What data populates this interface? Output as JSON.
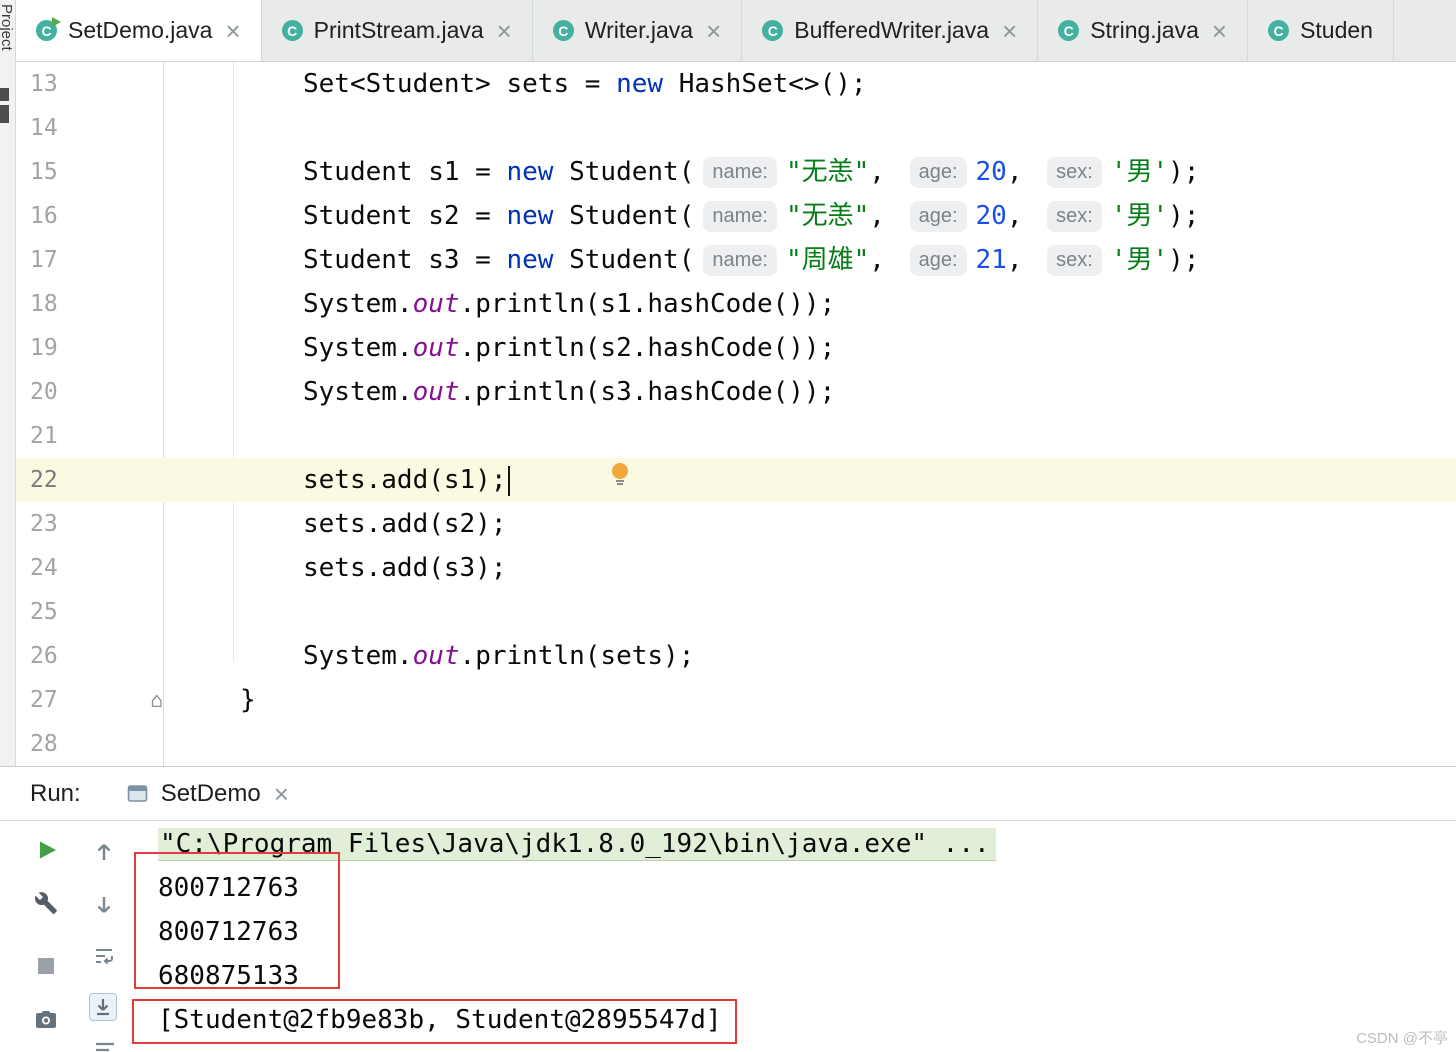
{
  "window": {
    "left_strip_label": "Project"
  },
  "tabs": [
    {
      "label": "SetDemo.java",
      "icon": "class-icon",
      "run_marker": true,
      "active": true,
      "closable": true
    },
    {
      "label": "PrintStream.java",
      "icon": "class-icon",
      "run_marker": false,
      "active": false,
      "closable": true
    },
    {
      "label": "Writer.java",
      "icon": "class-icon",
      "run_marker": false,
      "active": false,
      "closable": true
    },
    {
      "label": "BufferedWriter.java",
      "icon": "class-icon",
      "run_marker": false,
      "active": false,
      "closable": true
    },
    {
      "label": "String.java",
      "icon": "class-icon",
      "run_marker": false,
      "active": false,
      "closable": true
    },
    {
      "label": "Studen",
      "icon": "class-icon",
      "run_marker": false,
      "active": false,
      "closable": false
    }
  ],
  "editor": {
    "lines": [
      {
        "num": "13",
        "indent": 2,
        "tokens": [
          {
            "t": "Set<Student> sets = ",
            "s": "p"
          },
          {
            "t": "new",
            "s": "kw"
          },
          {
            "t": " HashSet<>();",
            "s": "p"
          }
        ]
      },
      {
        "num": "14",
        "indent": 2,
        "tokens": []
      },
      {
        "num": "15",
        "indent": 2,
        "tokens": [
          {
            "t": "Student s1 = ",
            "s": "p"
          },
          {
            "t": "new",
            "s": "kw"
          },
          {
            "t": " Student(",
            "s": "p"
          },
          {
            "t": "name:",
            "s": "hint"
          },
          {
            "t": "\"无恙\"",
            "s": "str"
          },
          {
            "t": ", ",
            "s": "p"
          },
          {
            "t": "age:",
            "s": "hint"
          },
          {
            "t": "20",
            "s": "num"
          },
          {
            "t": ", ",
            "s": "p"
          },
          {
            "t": "sex:",
            "s": "hint"
          },
          {
            "t": "'男'",
            "s": "str"
          },
          {
            "t": ");",
            "s": "p"
          }
        ]
      },
      {
        "num": "16",
        "indent": 2,
        "tokens": [
          {
            "t": "Student s2 = ",
            "s": "p"
          },
          {
            "t": "new",
            "s": "kw"
          },
          {
            "t": " Student(",
            "s": "p"
          },
          {
            "t": "name:",
            "s": "hint"
          },
          {
            "t": "\"无恙\"",
            "s": "str"
          },
          {
            "t": ", ",
            "s": "p"
          },
          {
            "t": "age:",
            "s": "hint"
          },
          {
            "t": "20",
            "s": "num"
          },
          {
            "t": ", ",
            "s": "p"
          },
          {
            "t": "sex:",
            "s": "hint"
          },
          {
            "t": "'男'",
            "s": "str"
          },
          {
            "t": ");",
            "s": "p"
          }
        ]
      },
      {
        "num": "17",
        "indent": 2,
        "tokens": [
          {
            "t": "Student s3 = ",
            "s": "p"
          },
          {
            "t": "new",
            "s": "kw"
          },
          {
            "t": " Student(",
            "s": "p"
          },
          {
            "t": "name:",
            "s": "hint"
          },
          {
            "t": "\"周雄\"",
            "s": "str"
          },
          {
            "t": ", ",
            "s": "p"
          },
          {
            "t": "age:",
            "s": "hint"
          },
          {
            "t": "21",
            "s": "num"
          },
          {
            "t": ", ",
            "s": "p"
          },
          {
            "t": "sex:",
            "s": "hint"
          },
          {
            "t": "'男'",
            "s": "str"
          },
          {
            "t": ");",
            "s": "p"
          }
        ]
      },
      {
        "num": "18",
        "indent": 2,
        "tokens": [
          {
            "t": "System.",
            "s": "p"
          },
          {
            "t": "out",
            "s": "fld"
          },
          {
            "t": ".println(s1.hashCode());",
            "s": "p"
          }
        ]
      },
      {
        "num": "19",
        "indent": 2,
        "tokens": [
          {
            "t": "System.",
            "s": "p"
          },
          {
            "t": "out",
            "s": "fld"
          },
          {
            "t": ".println(s2.hashCode());",
            "s": "p"
          }
        ]
      },
      {
        "num": "20",
        "indent": 2,
        "tokens": [
          {
            "t": "System.",
            "s": "p"
          },
          {
            "t": "out",
            "s": "fld"
          },
          {
            "t": ".println(s3.hashCode());",
            "s": "p"
          }
        ]
      },
      {
        "num": "21",
        "indent": 2,
        "tokens": []
      },
      {
        "num": "22",
        "indent": 2,
        "current": true,
        "tokens": [
          {
            "t": "sets.add(s1);",
            "s": "p"
          }
        ]
      },
      {
        "num": "23",
        "indent": 2,
        "tokens": [
          {
            "t": "sets.add(s2);",
            "s": "p"
          }
        ]
      },
      {
        "num": "24",
        "indent": 2,
        "tokens": [
          {
            "t": "sets.add(s3);",
            "s": "p"
          }
        ]
      },
      {
        "num": "25",
        "indent": 2,
        "tokens": []
      },
      {
        "num": "26",
        "indent": 2,
        "tokens": [
          {
            "t": "System.",
            "s": "p"
          },
          {
            "t": "out",
            "s": "fld"
          },
          {
            "t": ".println(sets);",
            "s": "p"
          }
        ]
      },
      {
        "num": "27",
        "indent": 1,
        "gutter_icon": true,
        "tokens": [
          {
            "t": "}",
            "s": "p"
          }
        ]
      },
      {
        "num": "28",
        "indent": 2,
        "tokens": []
      }
    ]
  },
  "run_panel": {
    "run_label": "Run:",
    "tab_label": "SetDemo",
    "toolbar_left_icons": [
      "run-icon",
      "wrench-settings-icon",
      "stop-icon",
      "screenshot-camera-icon"
    ],
    "toolbar_secondary_icons": [
      "up-stack-trace-icon",
      "down-stack-trace-icon",
      "soft-wrap-icon",
      "scroll-to-end-icon",
      "print-icon"
    ],
    "console_lines": [
      {
        "text": "\"C:\\Program Files\\Java\\jdk1.8.0_192\\bin\\java.exe\" ...",
        "highlight": true
      },
      {
        "text": "800712763",
        "highlight": false
      },
      {
        "text": "800712763",
        "highlight": false
      },
      {
        "text": "680875133",
        "highlight": false
      },
      {
        "text": "[Student@2fb9e83b, Student@2895547d]",
        "highlight": false
      }
    ]
  },
  "colors": {
    "keyword": "#0033b3",
    "string": "#067d17",
    "number": "#1750eb",
    "static_field": "#871094",
    "current_line_highlight": "#fcf9e3",
    "annotation_red": "#e23b3b",
    "console_command_highlight": "#e1eed8",
    "class_icon": "#43b0a0"
  },
  "watermark": "CSDN @不亭"
}
